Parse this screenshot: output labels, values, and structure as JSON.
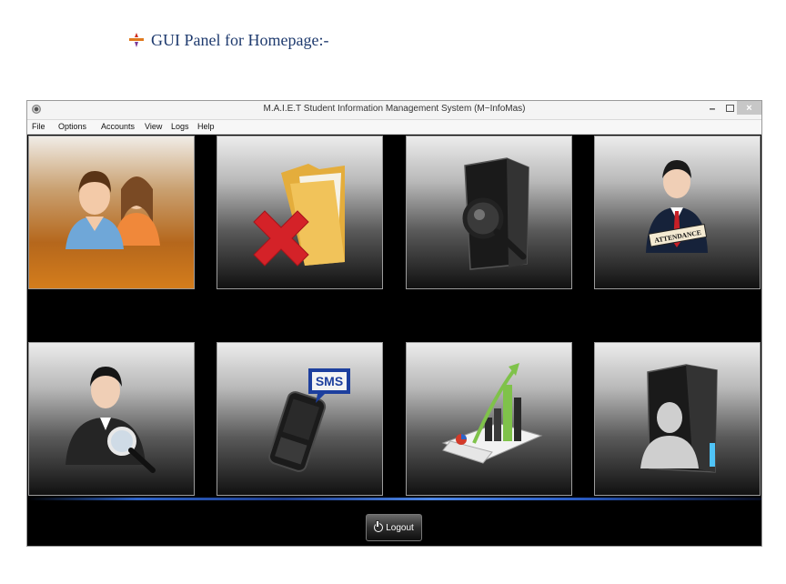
{
  "doc_heading": "GUI Panel for Homepage:-",
  "window": {
    "title": "M.A.I.E.T Student Information Management System (M~InfoMas)",
    "controls": {
      "minimize": "–",
      "close": "×"
    }
  },
  "menu": [
    "File",
    "Options",
    "Accounts",
    "View",
    "Logs",
    "Help"
  ],
  "tiles": [
    {
      "icon": "users-icon",
      "selected": true
    },
    {
      "icon": "delete-folder-icon"
    },
    {
      "icon": "search-folder-icon"
    },
    {
      "icon": "attendance-icon",
      "badge_text": "ATTENDANCE"
    },
    {
      "icon": "user-search-icon"
    },
    {
      "icon": "sms-phone-icon",
      "badge_text": "SMS"
    },
    {
      "icon": "report-chart-icon"
    },
    {
      "icon": "user-folder-icon"
    }
  ],
  "logout_label": "Logout",
  "colors": {
    "accent": "#d47d1c",
    "glow": "#2d63c8",
    "heading": "#1e3a6e"
  }
}
